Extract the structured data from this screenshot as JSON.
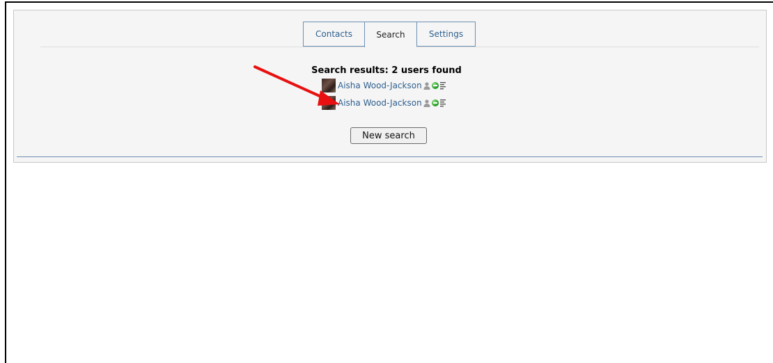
{
  "tabs": [
    {
      "label": "Contacts"
    },
    {
      "label": "Search"
    },
    {
      "label": "Settings"
    }
  ],
  "active_tab": "Search",
  "results": {
    "title": "Search results: 2 users found",
    "users": [
      {
        "name": "Aisha Wood-Jackson",
        "status": "online"
      },
      {
        "name": "Aisha Wood-Jackson",
        "status": "online"
      }
    ]
  },
  "buttons": {
    "new_search": "New search"
  },
  "colors": {
    "link": "#2e5f8e",
    "tab_border": "#6e8fb3",
    "arrow": "#e81010",
    "online": "#1f9a1f"
  }
}
